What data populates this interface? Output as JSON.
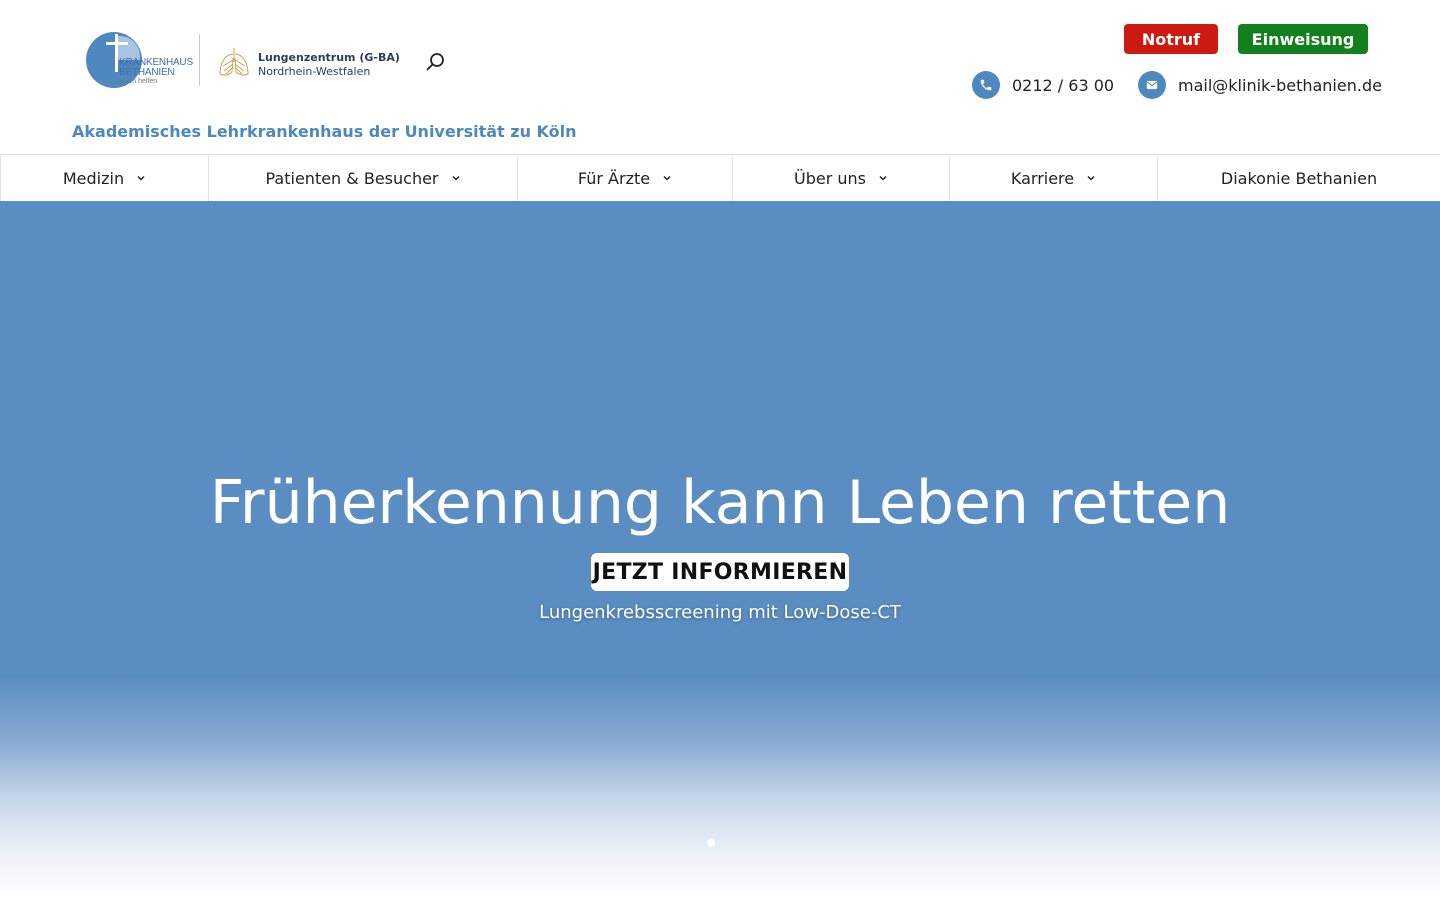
{
  "header": {
    "logo_bethanien": {
      "line1": "KRANKENHAUS",
      "line2": "BETHANIEN",
      "tagline": "leben helfen"
    },
    "logo_lungenzentrum": {
      "line1": "Lungenzentrum (G-BA)",
      "line2": "Nordrhein-Westfalen"
    },
    "subline": "Akademisches Lehrkrankenhaus der Universität zu Köln",
    "buttons": {
      "notruf": "Notruf",
      "einweisung": "Einweisung"
    },
    "contact": {
      "phone": "0212 / 63 00",
      "email": "mail@klinik-bethanien.de"
    },
    "icons": {
      "search": "search-icon",
      "phone": "phone-icon",
      "mail": "mail-icon"
    }
  },
  "nav": {
    "items": [
      {
        "label": "Medizin",
        "has_dropdown": true
      },
      {
        "label": "Patienten & Besucher",
        "has_dropdown": true
      },
      {
        "label": "Für Ärzte",
        "has_dropdown": true
      },
      {
        "label": "Über uns",
        "has_dropdown": true
      },
      {
        "label": "Karriere",
        "has_dropdown": true
      },
      {
        "label": "Diakonie Bethanien",
        "has_dropdown": false
      }
    ]
  },
  "hero": {
    "title": "Früherkennung kann Leben retten",
    "cta": "JETZT INFORMIEREN",
    "subtitle": "Lungenkrebsscreening mit Low-Dose-CT",
    "slide_count": 1,
    "active_slide": 1
  },
  "colors": {
    "brand_blue": "#4f87bf",
    "hero_blue": "#5a8ec2",
    "notruf_red": "#cc1a10",
    "einweisung_green": "#13801e",
    "text_dark": "#222222"
  }
}
